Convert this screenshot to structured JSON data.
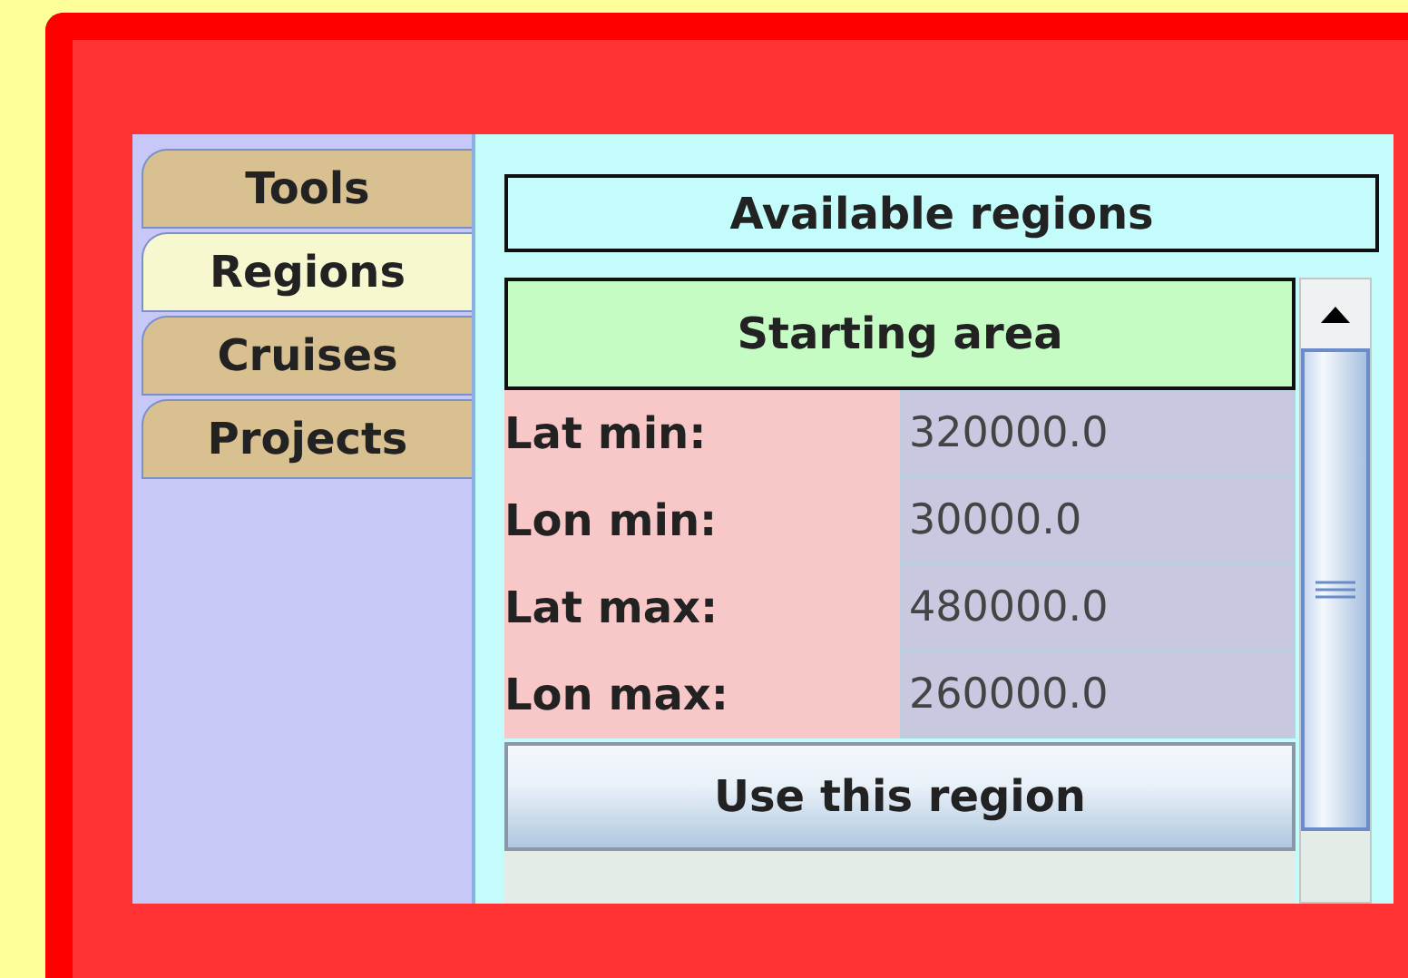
{
  "tabs": [
    {
      "label": "Tools",
      "selected": false
    },
    {
      "label": "Regions",
      "selected": true
    },
    {
      "label": "Cruises",
      "selected": false
    },
    {
      "label": "Projects",
      "selected": false
    }
  ],
  "panel_title": "Available regions",
  "region": {
    "title": "Starting area",
    "fields": [
      {
        "label": "Lat min:",
        "value": "320000.0"
      },
      {
        "label": "Lon min:",
        "value": "30000.0"
      },
      {
        "label": "Lat max:",
        "value": "480000.0"
      },
      {
        "label": "Lon max:",
        "value": "260000.0"
      }
    ],
    "button": "Use this region"
  }
}
